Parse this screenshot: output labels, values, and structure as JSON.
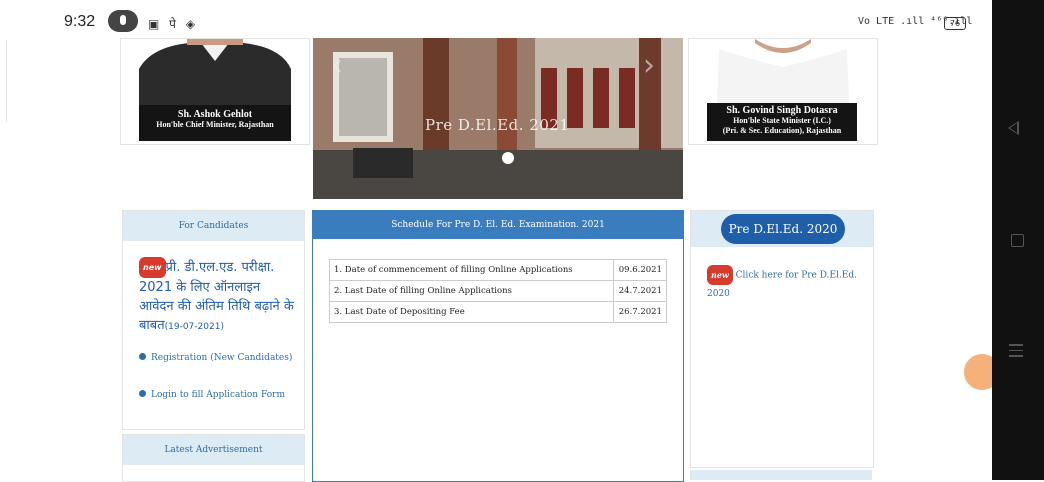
{
  "status_bar": {
    "time": "9:32",
    "left_icons": "▣ पे ◈",
    "network": "Vo LTE .ıll ⁴⁶ᴳ.ıll",
    "battery": "76"
  },
  "header": {
    "left_person": {
      "name": "Sh. Ashok Gehlot",
      "designation": "Hon'ble Chief Minister, Rajasthan"
    },
    "right_person": {
      "name": "Sh. Govind Singh Dotasra",
      "designation_line1": "Hon'ble State Minister (I.C.)",
      "designation_line2": "(Pri. & Sec. Education), Rajasthan"
    },
    "slider_caption": "Pre D.El.Ed. 2021"
  },
  "candidates_panel": {
    "title": "For Candidates",
    "new_badge": "new",
    "notice_hindi": "प्री. डी.एल.एड. परीक्षा. 2021 के लिए ऑनलाइन आवेदन की अंतिम तिथि बढ़ाने के बाबत",
    "notice_date": "(19-07-2021)",
    "links": [
      "Registration (New Candidates)",
      "Login to fill Application Form"
    ]
  },
  "latest_panel": {
    "title": "Latest Advertisement"
  },
  "schedule": {
    "title": "Schedule For Pre D. El. Ed. Examination. 2021",
    "rows": [
      {
        "label": "1. Date of commencement of filling Online Applications",
        "date": "09.6.2021"
      },
      {
        "label": "2. Last Date of filling Online Applications",
        "date": "24.7.2021"
      },
      {
        "label": "3. Last Date of Depositing Fee",
        "date": "26.7.2021"
      }
    ]
  },
  "pre_panel": {
    "title": "Pre D.El.Ed. 2020",
    "new_badge": "new",
    "link": "Click here for Pre D.El.Ed. 2020"
  },
  "colors": {
    "accent": "#3a7dbf",
    "panel_head": "#dcebf4",
    "link": "#2e6da4",
    "badge": "#d63b2d"
  }
}
